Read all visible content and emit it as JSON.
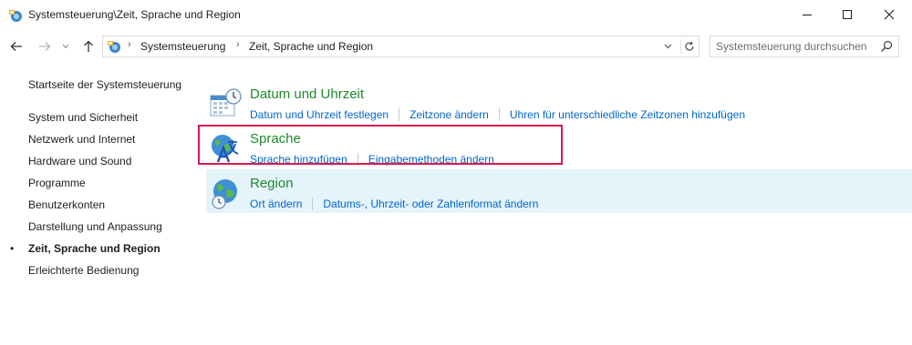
{
  "window": {
    "title": "Systemsteuerung\\Zeit, Sprache und Region",
    "minimize_label": "",
    "maximize_label": "",
    "close_label": ""
  },
  "address": {
    "crumbs": [
      "Systemsteuerung",
      "Zeit, Sprache und Region"
    ],
    "search_placeholder": "Systemsteuerung durchsuchen"
  },
  "sidebar": {
    "home_label": "Startseite der Systemsteuerung",
    "items": [
      {
        "label": "System und Sicherheit",
        "active": false
      },
      {
        "label": "Netzwerk und Internet",
        "active": false
      },
      {
        "label": "Hardware und Sound",
        "active": false
      },
      {
        "label": "Programme",
        "active": false
      },
      {
        "label": "Benutzerkonten",
        "active": false
      },
      {
        "label": "Darstellung und Anpassung",
        "active": false
      },
      {
        "label": "Zeit, Sprache und Region",
        "active": true
      },
      {
        "label": "Erleichterte Bedienung",
        "active": false
      }
    ],
    "bullet": "•"
  },
  "categories": [
    {
      "icon": "calendar-clock-icon",
      "title": "Datum und Uhrzeit",
      "links": [
        "Datum und Uhrzeit festlegen",
        "Zeitzone ändern",
        "Uhren für unterschiedliche Zeitzonen hinzufügen"
      ],
      "highlighted": false,
      "hovered": false
    },
    {
      "icon": "globe-language-icon",
      "title": "Sprache",
      "links": [
        "Sprache hinzufügen",
        "Eingabemethoden ändern"
      ],
      "highlighted": true,
      "hovered": false
    },
    {
      "icon": "globe-clock-icon",
      "title": "Region",
      "links": [
        "Ort ändern",
        "Datums-, Uhrzeit- oder Zahlenformat ändern"
      ],
      "highlighted": false,
      "hovered": true
    }
  ],
  "colors": {
    "category_title": "#1e8a2c",
    "link": "#0066cc",
    "hover_background": "#e5f3fb",
    "highlight_border": "#e1154d"
  }
}
